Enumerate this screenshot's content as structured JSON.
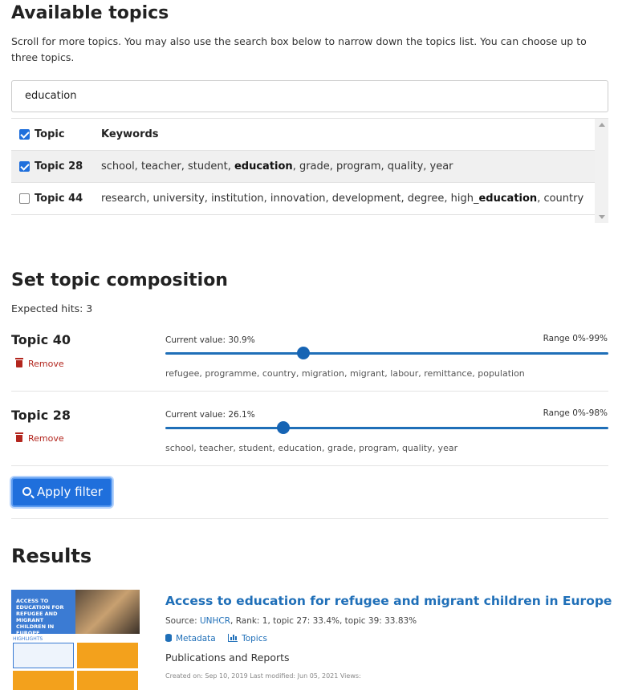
{
  "available_topics": {
    "heading": "Available topics",
    "instructions": "Scroll for more topics. You may also use the search box below to narrow down the topics list. You can choose up to three topics.",
    "search_value": "education",
    "table": {
      "headers": {
        "topic": "Topic",
        "keywords": "Keywords"
      },
      "rows": [
        {
          "topic": "Topic 28",
          "checked": true,
          "kw_before": "school, teacher, student, ",
          "kw_bold": "education",
          "kw_after": ", grade, program, quality, year"
        },
        {
          "topic": "Topic 44",
          "checked": false,
          "kw_before": "research, university, institution, innovation, development, degree, high_",
          "kw_bold": "education",
          "kw_after": ", country"
        }
      ]
    }
  },
  "composition": {
    "heading": "Set topic composition",
    "expected_hits": "Expected hits: 3",
    "remove_label": "Remove",
    "items": [
      {
        "name": "Topic 40",
        "current": "Current value: 30.9%",
        "range": "Range 0%-99%",
        "value_fraction": 0.309,
        "range_max": 0.99,
        "keywords": "refugee, programme, country, migration, migrant, labour, remittance, population"
      },
      {
        "name": "Topic 28",
        "current": "Current value: 26.1%",
        "range": "Range 0%-98%",
        "value_fraction": 0.261,
        "range_max": 0.98,
        "keywords": "school, teacher, student, education, grade, program, quality, year"
      }
    ],
    "apply_label": "Apply filter"
  },
  "results": {
    "heading": "Results",
    "items": [
      {
        "title": "Access to education for refugee and migrant children in Europe",
        "source_label": "Source: ",
        "source": "UNHCR",
        "meta_rest": ", Rank: 1, topic 27: 33.4%, topic 39: 33.83%",
        "link_metadata": "Metadata",
        "link_topics": "Topics",
        "type": "Publications and Reports",
        "dates": "Created on: Sep 10, 2019 Last modified: Jun 05, 2021 Views:",
        "thumb_title": "ACCESS TO EDUCATION FOR REFUGEE AND MIGRANT CHILDREN IN EUROPE",
        "thumb_highlights": "HIGHLIGHTS"
      }
    ]
  },
  "colors": {
    "primary": "#1f6fdc",
    "link": "#1f6fb8",
    "remove": "#b3261e"
  }
}
